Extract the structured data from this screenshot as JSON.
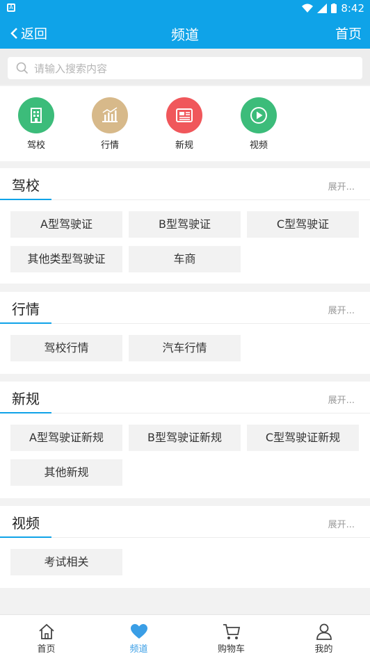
{
  "status": {
    "time": "8:42"
  },
  "header": {
    "back_label": "返回",
    "title": "频道",
    "home_label": "首页"
  },
  "search": {
    "placeholder": "请输入搜索内容"
  },
  "categories": [
    {
      "label": "驾校",
      "color": "#3cbc7a",
      "icon": "building-icon"
    },
    {
      "label": "行情",
      "color": "#d7b98a",
      "icon": "bar-chart-icon"
    },
    {
      "label": "新规",
      "color": "#f0575b",
      "icon": "newspaper-icon"
    },
    {
      "label": "视频",
      "color": "#3cbc7a",
      "icon": "play-icon"
    }
  ],
  "sections": [
    {
      "title": "驾校",
      "more": "展开...",
      "tags": [
        "A型驾驶证",
        "B型驾驶证",
        "C型驾驶证",
        "其他类型驾驶证",
        "车商"
      ]
    },
    {
      "title": "行情",
      "more": "展开...",
      "tags": [
        "驾校行情",
        "汽车行情"
      ]
    },
    {
      "title": "新规",
      "more": "展开...",
      "tags": [
        "A型驾驶证新规",
        "B型驾驶证新规",
        "C型驾驶证新规",
        "其他新规"
      ]
    },
    {
      "title": "视频",
      "more": "展开...",
      "tags": [
        "考试相关"
      ]
    }
  ],
  "tabbar": [
    {
      "label": "首页",
      "icon": "home-icon",
      "active": false
    },
    {
      "label": "频道",
      "icon": "heart-icon",
      "active": true
    },
    {
      "label": "购物车",
      "icon": "cart-icon",
      "active": false
    },
    {
      "label": "我的",
      "icon": "user-icon",
      "active": false
    }
  ],
  "colors": {
    "primary": "#0fa3e8",
    "active_tab": "#3a9ee6"
  }
}
